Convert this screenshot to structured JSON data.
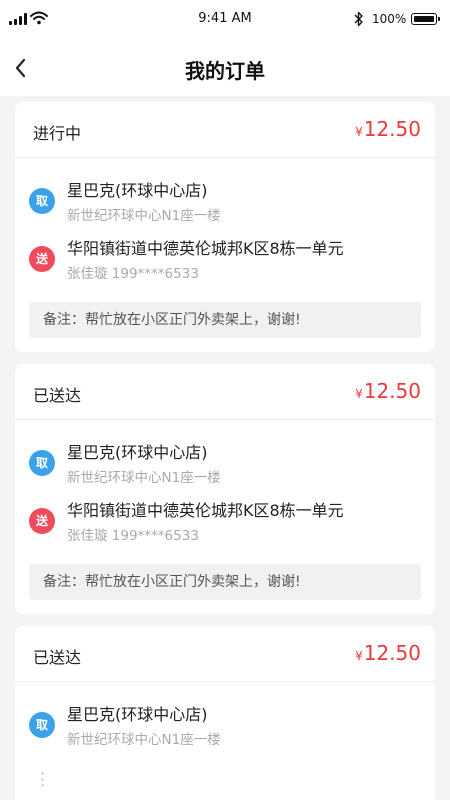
{
  "status_bar": {
    "time": "9:41 AM",
    "battery": "100%"
  },
  "nav": {
    "title": "我的订单"
  },
  "orders": [
    {
      "status": "进行中",
      "currency": "¥",
      "price": "12.50",
      "pickup": {
        "badge": "取",
        "name": "星巴克(环球中心店)",
        "address": "新世纪环球中心N1座一楼"
      },
      "delivery": {
        "badge": "送",
        "address": "华阳镇街道中德英伦城邦K区8栋一单元",
        "contact": "张佳璇 199****6533"
      },
      "note": "备注：帮忙放在小区正门外卖架上，谢谢!"
    },
    {
      "status": "已送达",
      "currency": "¥",
      "price": "12.50",
      "pickup": {
        "badge": "取",
        "name": "星巴克(环球中心店)",
        "address": "新世纪环球中心N1座一楼"
      },
      "delivery": {
        "badge": "送",
        "address": "华阳镇街道中德英伦城邦K区8栋一单元",
        "contact": "张佳璇 199****6533"
      },
      "note": "备注：帮忙放在小区正门外卖架上，谢谢!"
    },
    {
      "status": "已送达",
      "currency": "¥",
      "price": "12.50",
      "pickup": {
        "badge": "取",
        "name": "星巴克(环球中心店)",
        "address": "新世纪环球中心N1座一楼"
      }
    }
  ],
  "colors": {
    "price": "#ea3a3a",
    "pickup_badge": "#3ba1e8",
    "delivery_badge": "#ef4c5b",
    "background": "#f4f4f4"
  },
  "icons": {
    "back": "chevron-left-icon",
    "signal": "signal-icon",
    "wifi": "wifi-icon",
    "bluetooth": "bluetooth-icon",
    "battery": "battery-icon"
  }
}
